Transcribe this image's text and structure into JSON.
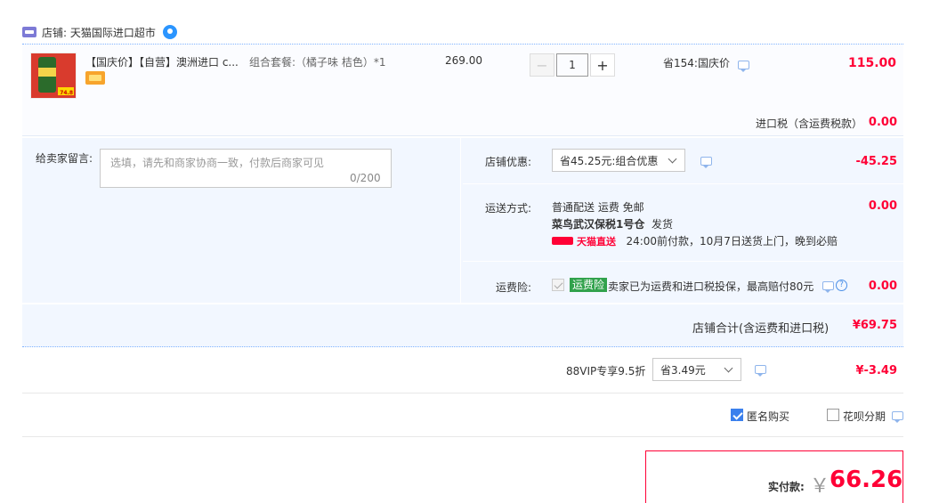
{
  "store": {
    "label": "店铺: 天猫国际进口超市"
  },
  "item": {
    "title": "【国庆价】【自营】澳洲进口 c...",
    "sku": "组合套餐:（橘子味 桔色）*1",
    "unit_price": "269.00",
    "quantity": "1",
    "minus": "−",
    "plus": "+",
    "promo": "省154:国庆价",
    "total": "115.00",
    "thumb_price": "74.8"
  },
  "tax": {
    "label": "进口税（含运费税款）",
    "value": "0.00"
  },
  "message": {
    "label": "给卖家留言:",
    "placeholder": "选填，请先和商家协商一致，付款后商家可见",
    "count": "0/200"
  },
  "shop_discount": {
    "label": "店铺优惠:",
    "selected": "省45.25元:组合优惠",
    "value": "-45.25"
  },
  "shipping": {
    "label": "运送方式:",
    "line1": "普通配送 运费 免邮",
    "line2_warehouse": "菜鸟武汉保税1号仓",
    "line2_suffix": "发货",
    "badge": "天猫直送",
    "line3": "24:00前付款，10月7日送货上门，晚到必赔",
    "value": "0.00"
  },
  "insurance": {
    "label": "运费险:",
    "badge": "运费险",
    "text": "卖家已为运费和进口税投保，最高赔付80元",
    "help": "?",
    "value": "0.00"
  },
  "subtotal": {
    "label": "店铺合计(含运费和进口税)",
    "value": "¥69.75"
  },
  "vip": {
    "label": "88VIP专享9.5折",
    "selected": "省3.49元",
    "value": "¥-3.49"
  },
  "options": {
    "anonymous": "匿名购买",
    "installment": "花呗分期"
  },
  "payment": {
    "label": "实付款:",
    "currency": "￥",
    "value": "66.26"
  },
  "colors": {
    "accent": "#ff0036",
    "panel": "#f2f7ff",
    "link": "#3b80ed"
  }
}
